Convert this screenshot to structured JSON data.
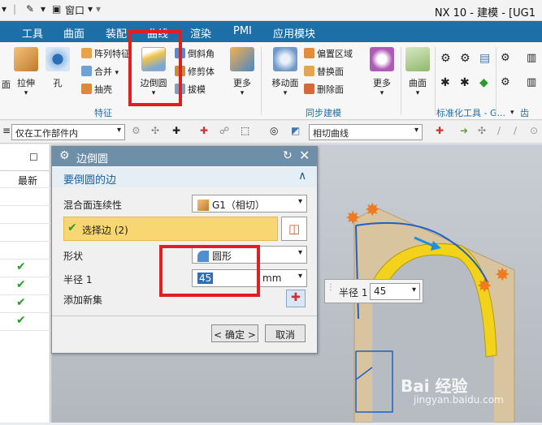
{
  "titlebar": {
    "window_menu": "窗口",
    "app_title": "NX 10 - 建模 - [UG1"
  },
  "menu_tabs": [
    "工具",
    "曲面",
    "装配",
    "曲线",
    "渲染",
    "PMI",
    "应用模块"
  ],
  "ribbon": {
    "left_stub": "面",
    "extrude": "拉伸",
    "hole": "孔",
    "pattern_feature": "阵列特征",
    "unite": "合并",
    "shell": "抽壳",
    "edge_blend": "边倒圆",
    "chamfer": "倒斜角",
    "trim_body": "修剪体",
    "draft": "拔模",
    "more1": "更多",
    "feature_group": "特征",
    "move_face": "移动面",
    "offset_region": "偏置区域",
    "replace_face": "替换面",
    "delete_face": "删除面",
    "more2": "更多",
    "sync_group": "同步建模",
    "surface": "曲面",
    "std_tools_group": "标准化工具 - G...",
    "gear_group": "齿轮..."
  },
  "toolbar": {
    "scope_combo": "仅在工作部件内",
    "curve_rule_combo": "相切曲线"
  },
  "left_panel": {
    "header": "最新",
    "checks": [
      "✔",
      "✔",
      "✔",
      "✔"
    ]
  },
  "dialog": {
    "title": "边倒圆",
    "section": "要倒圆的边",
    "continuity_label": "混合面连续性",
    "continuity_value": "G1（相切）",
    "select_edge": "选择边 (2)",
    "shape_label": "形状",
    "shape_value": "圆形",
    "radius_label": "半径 1",
    "radius_value": "45",
    "radius_unit": "mm",
    "add_set_label": "添加新集",
    "ok_button": "< 确定 >",
    "cancel_button": "取消"
  },
  "float_radius": {
    "label": "半径 1",
    "value": "45"
  },
  "watermark": {
    "brand": "Bai 经验",
    "url": "jingyan.baidu.com"
  },
  "colors": {
    "menu_blue": "#1d6fa8",
    "highlight": "#f8d772",
    "annotation_red": "#e02020",
    "yellow_surface": "#f2d21a"
  }
}
